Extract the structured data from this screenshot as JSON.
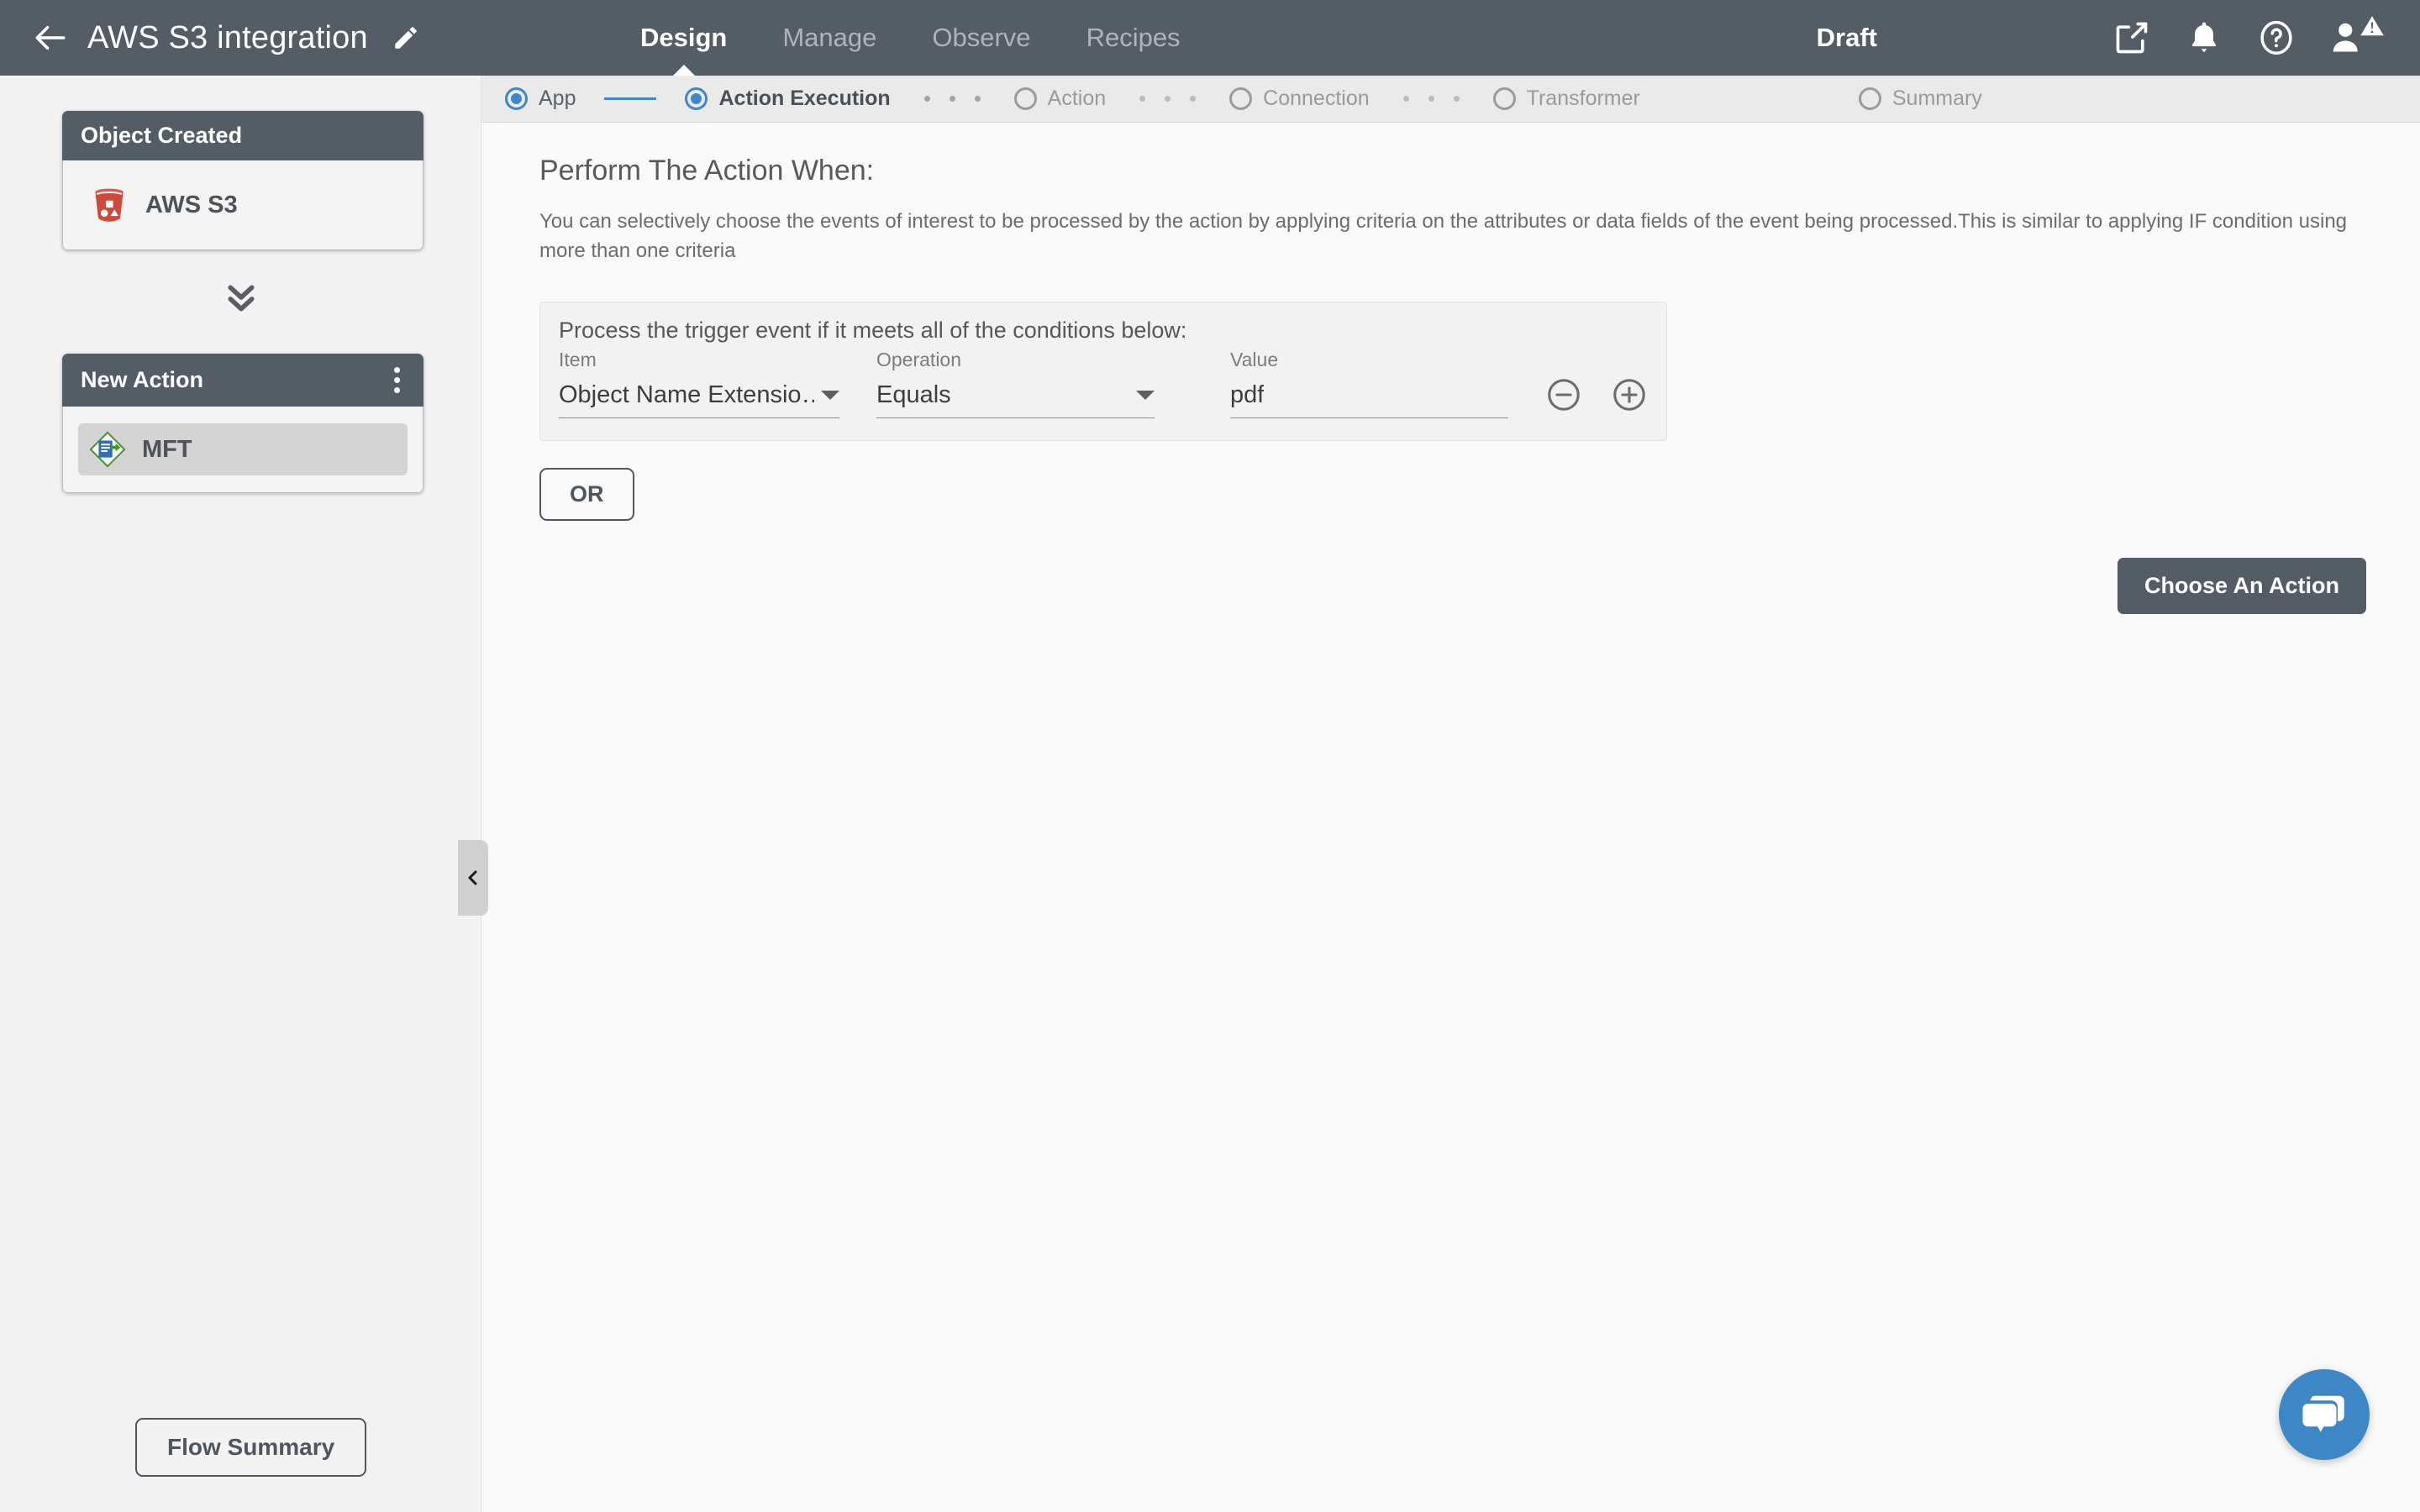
{
  "header": {
    "back_icon": "back-arrow-icon",
    "title": "AWS S3 integration",
    "edit_icon": "pencil-icon",
    "tabs": [
      {
        "label": "Design",
        "active": true
      },
      {
        "label": "Manage",
        "active": false
      },
      {
        "label": "Observe",
        "active": false
      },
      {
        "label": "Recipes",
        "active": false
      }
    ],
    "status": "Draft",
    "icons": [
      "external-link-icon",
      "bell-icon",
      "help-circle-icon",
      "user-avatar-icon",
      "warning-triangle-icon"
    ],
    "bg_color": "#545c66"
  },
  "stepper": {
    "steps": [
      {
        "label": "App",
        "state": "done"
      },
      {
        "label": "Action Execution",
        "state": "current"
      },
      {
        "label": "Action",
        "state": "todo"
      },
      {
        "label": "Connection",
        "state": "todo"
      },
      {
        "label": "Transformer",
        "state": "todo"
      },
      {
        "label": "Summary",
        "state": "todo"
      }
    ],
    "accent_color": "#3f87c9",
    "bg_color": "#eaeaea"
  },
  "sidebar": {
    "trigger_card": {
      "title": "Object Created",
      "item_label": "AWS S3",
      "item_icon": "aws-s3-bucket-icon"
    },
    "connector_icon": "double-chevron-down-icon",
    "action_card": {
      "title": "New Action",
      "menu_icon": "kebab-menu-icon",
      "item_label": "MFT",
      "item_icon": "mft-diamond-icon",
      "item_selected": true
    },
    "flow_summary_label": "Flow Summary",
    "collapse_icon": "chevron-left-icon"
  },
  "main": {
    "title": "Perform The Action When:",
    "description": "You can selectively choose the events of interest to be processed by the action by applying criteria on the attributes or data fields of the event being processed.This is similar to applying IF condition using more than one criteria",
    "condition_panel": {
      "title": "Process the trigger event if it meets all of the conditions below:",
      "fields": {
        "item": {
          "label": "Item",
          "value": "Object Name Extensio…"
        },
        "operation": {
          "label": "Operation",
          "value": "Equals"
        },
        "value": {
          "label": "Value",
          "value": "pdf"
        }
      },
      "remove_icon": "minus-circle-icon",
      "add_icon": "plus-circle-icon"
    },
    "or_label": "OR",
    "choose_action_label": "Choose An Action"
  },
  "chat": {
    "icon": "chat-bubble-icon",
    "color": "#3d87c6"
  }
}
